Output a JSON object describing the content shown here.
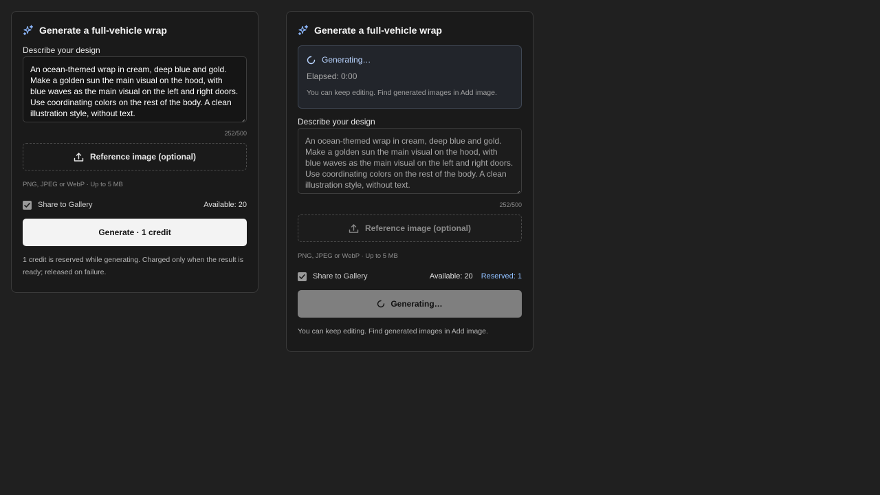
{
  "left_panel": {
    "title": "Generate a full-vehicle wrap",
    "icon": "sparkles-icon",
    "prompt_label": "Describe your design",
    "prompt_text": "An ocean-themed wrap in cream, deep blue and gold. Make a golden sun the main visual on the hood, with blue waves as the main visual on the left and right doors. Use coordinating colors on the rest of the body. A clean illustration style, without text.",
    "char_count": "252/500",
    "upload_label": "Reference image (optional)",
    "upload_icon": "upload-icon",
    "upload_hint": "PNG, JPEG or WebP · Up to 5 MB",
    "share_label": "Share to Gallery",
    "share_checked": true,
    "available": "Available: 20",
    "button_label": "Generate · 1 credit",
    "footnote": "1 credit is reserved while generating. Charged only when the result is ready; released on failure."
  },
  "right_panel": {
    "title": "Generate a full-vehicle wrap",
    "icon": "sparkles-icon",
    "status": {
      "label": "Generating…",
      "elapsed": "Elapsed: 0:00",
      "note": "You can keep editing. Find generated images in Add image."
    },
    "prompt_label": "Describe your design",
    "prompt_text": "An ocean-themed wrap in cream, deep blue and gold. Make a golden sun the main visual on the hood, with blue waves as the main visual on the left and right doors. Use coordinating colors on the rest of the body. A clean illustration style, without text.",
    "char_count": "252/500",
    "upload_label": "Reference image (optional)",
    "upload_icon": "upload-icon",
    "upload_hint": "PNG, JPEG or WebP · Up to 5 MB",
    "share_label": "Share to Gallery",
    "share_checked": true,
    "available": "Available: 20",
    "reserved": "Reserved: 1",
    "button_label": "Generating…",
    "footnote": "You can keep editing. Find generated images in Add image."
  },
  "colors": {
    "background": "#202020",
    "panel": "#1a1a1a",
    "accent_blue": "#8fbfff",
    "primary_button": "#f3f3f3",
    "busy_button": "#7f7f7f"
  }
}
